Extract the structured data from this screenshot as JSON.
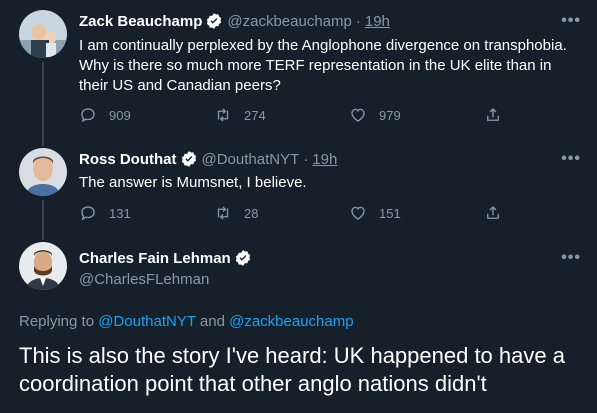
{
  "tweets": [
    {
      "name": "Zack Beauchamp",
      "handle": "@zackbeauchamp",
      "time": "19h",
      "text": "I am continually perplexed by the Anglophone divergence on transphobia. Why is there so much more TERF representation in the UK elite than in their US and Canadian peers?",
      "replies": "909",
      "retweets": "274",
      "likes": "979"
    },
    {
      "name": "Ross Douthat",
      "handle": "@DouthatNYT",
      "time": "19h",
      "text": "The answer is Mumsnet, I believe.",
      "replies": "131",
      "retweets": "28",
      "likes": "151"
    }
  ],
  "main_tweet": {
    "name": "Charles Fain Lehman",
    "handle": "@CharlesFLehman",
    "replying_prefix": "Replying to",
    "replying_to_1": "@DouthatNYT",
    "replying_and": "and",
    "replying_to_2": "@zackbeauchamp",
    "text": "This is also the story I've heard: UK happened to have a coordination point that other anglo nations didn't"
  },
  "more_label": "•••",
  "colors": {
    "background": "#15202b",
    "muted": "#8899a6",
    "accent": "#1da1f2",
    "divider": "#38444d"
  },
  "icons": [
    "verified-badge-icon",
    "reply-icon",
    "retweet-icon",
    "like-icon",
    "share-icon",
    "more-options-icon"
  ]
}
